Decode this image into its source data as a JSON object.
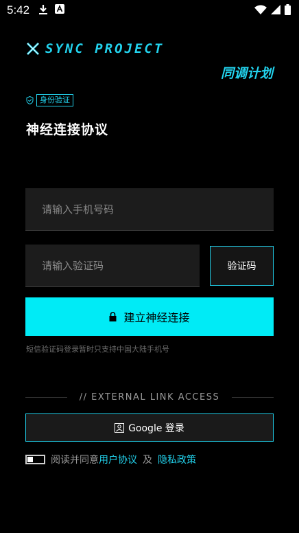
{
  "status_bar": {
    "time": "5:42",
    "left_icons": [
      "download-icon",
      "a-icon"
    ],
    "right_icons": [
      "wifi-icon",
      "signal-icon",
      "battery-icon"
    ]
  },
  "header": {
    "logo_text": "SYNC PROJECT",
    "subtitle": "同调计划"
  },
  "badge": {
    "label": "身份验证"
  },
  "page_title": "神经连接协议",
  "phone_input": {
    "placeholder": "请输入手机号码",
    "value": ""
  },
  "code_input": {
    "placeholder": "请输入验证码",
    "value": ""
  },
  "code_button": {
    "label": "验证码"
  },
  "connect_button": {
    "label": "建立神经连接"
  },
  "hint": "短信验证码登录暂时只支持中国大陆手机号",
  "divider": {
    "label": "// EXTERNAL LINK ACCESS"
  },
  "google_button": {
    "label": "Google 登录"
  },
  "agreement": {
    "prefix": "阅读并同意",
    "user_agreement": "用户协议",
    "and": "及",
    "privacy_policy": "隐私政策",
    "checked": false
  },
  "colors": {
    "accent": "#22d3ee",
    "button_fill": "#00ebf6",
    "background": "#000000",
    "field": "#1c1c1c"
  }
}
